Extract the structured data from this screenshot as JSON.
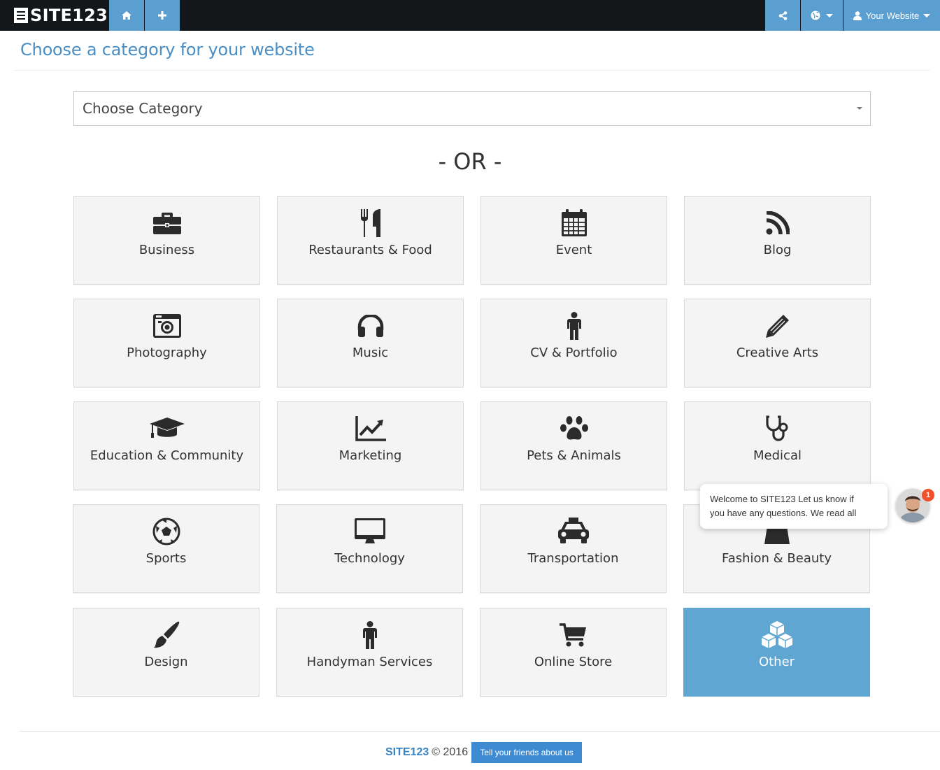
{
  "topbar": {
    "logo_text": "SITE123",
    "user_label": "Your Website",
    "nav_color": "#5b9fd1"
  },
  "page": {
    "title": "Choose a category for your website",
    "select_value": "Choose Category",
    "or_text": "- OR -"
  },
  "categories": [
    {
      "label": "Business",
      "icon": "briefcase-icon"
    },
    {
      "label": "Restaurants & Food",
      "icon": "cutlery-icon"
    },
    {
      "label": "Event",
      "icon": "calendar-icon"
    },
    {
      "label": "Blog",
      "icon": "rss-icon"
    },
    {
      "label": "Photography",
      "icon": "camera-icon"
    },
    {
      "label": "Music",
      "icon": "headphones-icon"
    },
    {
      "label": "CV & Portfolio",
      "icon": "person-icon"
    },
    {
      "label": "Creative Arts",
      "icon": "pencil-icon"
    },
    {
      "label": "Education & Community",
      "icon": "graduation-cap-icon"
    },
    {
      "label": "Marketing",
      "icon": "line-chart-icon"
    },
    {
      "label": "Pets & Animals",
      "icon": "paw-icon"
    },
    {
      "label": "Medical",
      "icon": "stethoscope-icon"
    },
    {
      "label": "Sports",
      "icon": "soccer-ball-icon"
    },
    {
      "label": "Technology",
      "icon": "monitor-icon"
    },
    {
      "label": "Transportation",
      "icon": "taxi-icon"
    },
    {
      "label": "Fashion & Beauty",
      "icon": "shopping-bag-icon"
    },
    {
      "label": "Design",
      "icon": "paintbrush-icon"
    },
    {
      "label": "Handyman Services",
      "icon": "person-icon"
    },
    {
      "label": "Online Store",
      "icon": "shopping-cart-icon"
    },
    {
      "label": "Other",
      "icon": "cubes-icon",
      "selected": true
    }
  ],
  "chat": {
    "line1": "Welcome to SITE123 Let us know if",
    "line2": "you have any questions. We read all",
    "badge": "1"
  },
  "footer": {
    "brand": "SITE123",
    "copyright": "© 2016",
    "share_button": "Tell your friends about us"
  }
}
